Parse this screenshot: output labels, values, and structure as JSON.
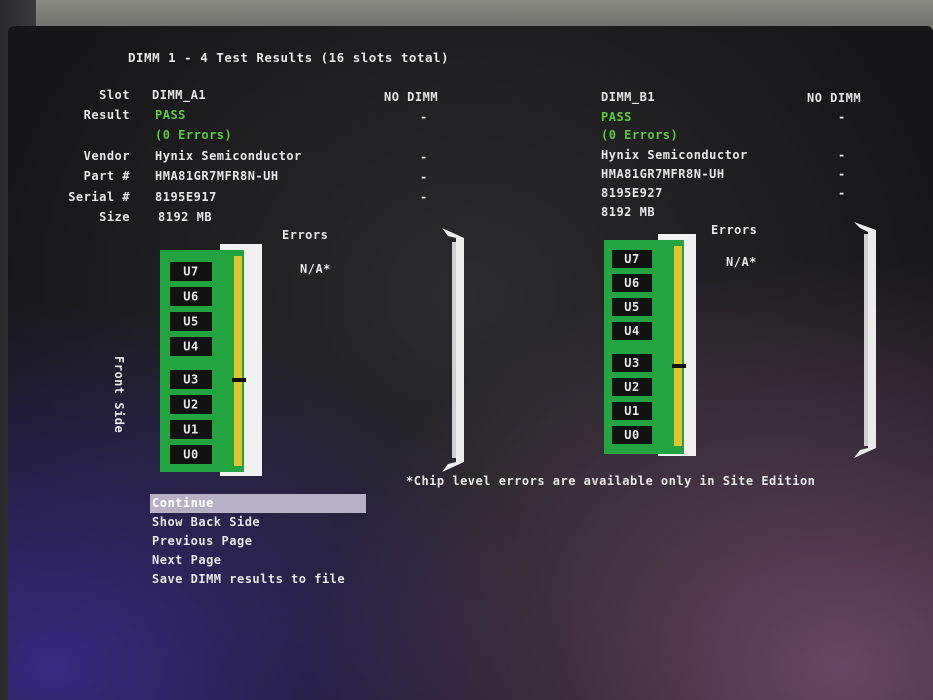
{
  "header": {
    "title": "DIMM 1 - 4 Test Results (16 slots total)"
  },
  "labels": {
    "slot": "Slot",
    "result": "Result",
    "vendor": "Vendor",
    "part": "Part #",
    "serial": "Serial #",
    "size": "Size"
  },
  "slots": [
    {
      "slot": "DIMM_A1",
      "result": "PASS",
      "errors": "(0 Errors)",
      "vendor": "Hynix Semiconductor",
      "part": "HMA81GR7MFR8N-UH",
      "serial": "8195E917",
      "size": "8192 MB"
    },
    {
      "slot": "NO DIMM",
      "result": "-",
      "vendor": "-",
      "part": "-",
      "serial": "-"
    },
    {
      "slot": "DIMM_B1",
      "result": "PASS",
      "errors": "(0 Errors)",
      "vendor": "Hynix Semiconductor",
      "part": "HMA81GR7MFR8N-UH",
      "serial": "8195E927",
      "size": "8192 MB"
    },
    {
      "slot": "NO DIMM",
      "result": "-",
      "vendor": "-",
      "part": "-",
      "serial": "-"
    }
  ],
  "errors_header": "Errors",
  "errors_value": "N/A*",
  "side_label": "Front Side",
  "chips": [
    "U7",
    "U6",
    "U5",
    "U4",
    "U3",
    "U2",
    "U1",
    "U0"
  ],
  "note": "*Chip level errors are available only in Site Edition",
  "menu": {
    "items": [
      "Continue",
      "Show Back Side",
      "Previous Page",
      "Next Page",
      "Save DIMM results to file"
    ],
    "selected": "Continue"
  },
  "colors": {
    "pass": "#5ecb3c",
    "module": "#22a43e",
    "gold": "#e2c22e",
    "text": "#e6e6e6"
  }
}
